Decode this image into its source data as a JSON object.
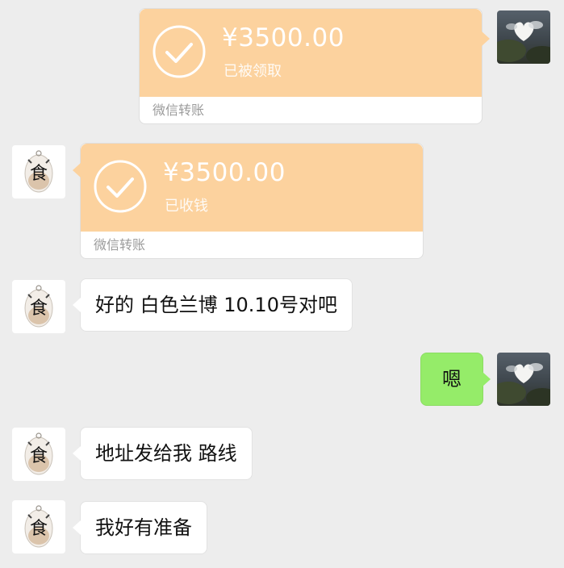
{
  "messages": {
    "transfer_sent": {
      "amount": "¥3500.00",
      "status": "已被领取",
      "footer": "微信转账"
    },
    "transfer_received": {
      "amount": "¥3500.00",
      "status": "已收钱",
      "footer": "微信转账"
    },
    "msg1": "好的 白色兰博 10.10号对吧",
    "msg2": "嗯",
    "msg3": "地址发给我 路线",
    "msg4": "我好有准备"
  },
  "colors": {
    "background": "#ededed",
    "transfer_orange": "#fcd29e",
    "sent_green": "#95ec69",
    "received_white": "#ffffff"
  }
}
